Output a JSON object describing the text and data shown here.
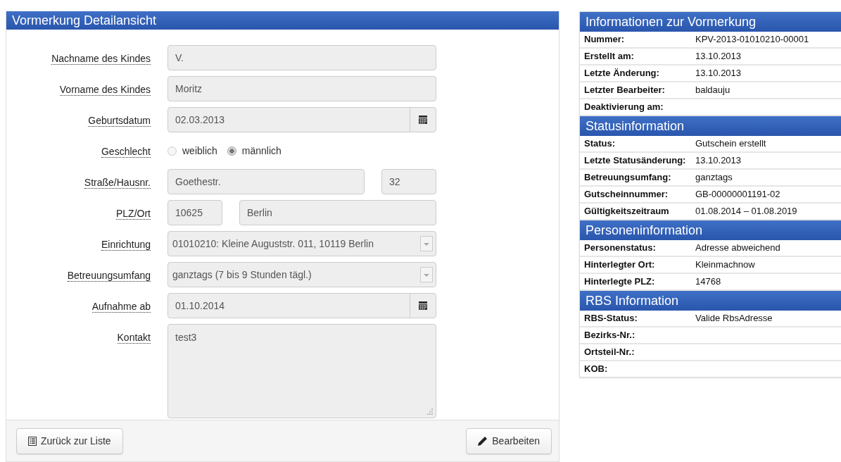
{
  "detail_panel": {
    "title": "Vormerkung Detailansicht",
    "fields": [
      {
        "kind": "text",
        "label": "Nachname des Kindes",
        "value": "V."
      },
      {
        "kind": "text",
        "label": "Vorname des Kindes",
        "value": "Moritz"
      },
      {
        "kind": "date",
        "label": "Geburtsdatum",
        "value": "02.03.2013"
      },
      {
        "kind": "radio",
        "label": "Geschlecht",
        "options": [
          {
            "label": "weiblich",
            "selected": false
          },
          {
            "label": "männlich",
            "selected": true
          }
        ]
      },
      {
        "kind": "pair",
        "label": "Straße/Hausnr.",
        "parts": [
          {
            "kind": "wide",
            "value": "Goethestr."
          },
          {
            "kind": "narrow",
            "value": "32"
          }
        ]
      },
      {
        "kind": "pair",
        "label": "PLZ/Ort",
        "parts": [
          {
            "kind": "narrow",
            "value": "10625"
          },
          {
            "kind": "wide",
            "value": "Berlin"
          }
        ]
      },
      {
        "kind": "select",
        "label": "Einrichtung",
        "value": "01010210: Kleine Auguststr. 011, 10119 Berlin"
      },
      {
        "kind": "select",
        "label": "Betreuungsumfang",
        "value": "ganztags (7 bis 9 Stunden tägl.)"
      },
      {
        "kind": "date",
        "label": "Aufnahme ab",
        "value": "01.10.2014"
      },
      {
        "kind": "textarea",
        "label": "Kontakt",
        "value": "test3"
      }
    ],
    "buttons": [
      {
        "kind": "list",
        "label": "Zurück zur Liste"
      },
      {
        "kind": "edit",
        "label": "Bearbeiten"
      }
    ]
  },
  "info_panel": {
    "sections": [
      {
        "title": "Informationen zur Vormerkung",
        "rows": [
          {
            "label": "Nummer:",
            "value": "KPV-2013-01010210-00001"
          },
          {
            "label": "Erstellt am:",
            "value": "13.10.2013"
          },
          {
            "label": "Letzte Änderung:",
            "value": "13.10.2013"
          },
          {
            "label": "Letzter Bearbeiter:",
            "value": "baldauju"
          },
          {
            "label": "Deaktivierung am:"
          }
        ]
      },
      {
        "title": "Statusinformation",
        "rows": [
          {
            "label": "Status:",
            "value": "Gutschein erstellt"
          },
          {
            "label": "Letzte Statusänderung:",
            "value": "13.10.2013"
          },
          {
            "label": "Betreuungsumfang:",
            "value": "ganztags"
          },
          {
            "label": "Gutscheinnummer:",
            "value": "GB-00000001191-02"
          },
          {
            "label": "Gültigkeitszeitraum",
            "value": "01.08.2014 – 01.08.2019"
          }
        ]
      },
      {
        "title": "Personeninformation",
        "rows": [
          {
            "label": "Personenstatus:",
            "value": "Adresse abweichend"
          },
          {
            "label": "Hinterlegter Ort:",
            "value": "Kleinmachnow"
          },
          {
            "label": "Hinterlegte PLZ:",
            "value": "14768"
          }
        ]
      },
      {
        "title": "RBS Information",
        "rows": [
          {
            "label": "RBS-Status:",
            "value": "Valide RbsAdresse"
          },
          {
            "label": "Bezirks-Nr.:"
          },
          {
            "label": "Ortsteil-Nr.:"
          },
          {
            "label": "KOB:"
          }
        ]
      }
    ]
  }
}
